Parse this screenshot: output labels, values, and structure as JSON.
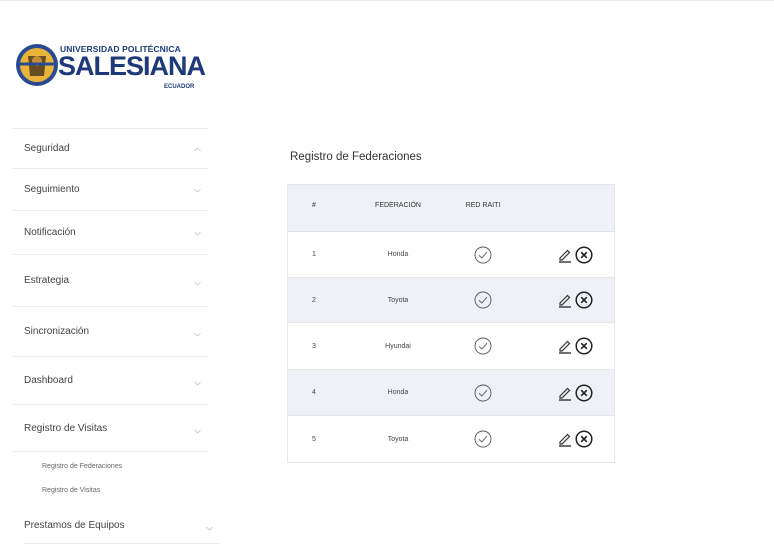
{
  "logo": {
    "university_line": "UNIVERSIDAD POLITÉCNICA",
    "name": "SALESIANA",
    "country": "ECUADOR"
  },
  "sidebar": {
    "items": [
      {
        "label": "Seguridad",
        "icon": "chevron-up-icon"
      },
      {
        "label": "Seguimiento",
        "icon": "chevron-down-icon"
      },
      {
        "label": "Notificación",
        "icon": "chevron-down-icon"
      },
      {
        "label": "Estrategia",
        "icon": "chevron-down-icon"
      },
      {
        "label": "Sincronización",
        "icon": "chevron-down-icon"
      },
      {
        "label": "Dashboard",
        "icon": "chevron-down-icon"
      },
      {
        "label": "Registro de Visitas",
        "icon": "chevron-down-icon"
      },
      {
        "label": "Prestamos de Equipos",
        "icon": "chevron-down-icon"
      }
    ],
    "subitems": [
      {
        "label": "Registro de Federaciones"
      },
      {
        "label": "Registro de Visitas"
      }
    ]
  },
  "main": {
    "title": "Registro de Federaciones",
    "table": {
      "headers": [
        "#",
        "FEDERACIÓN",
        "RED RAITI",
        ""
      ],
      "rows": [
        {
          "num": "1",
          "federacion": "Honda",
          "red_raiti": "check-circle-icon"
        },
        {
          "num": "2",
          "federacion": "Toyota",
          "red_raiti": "check-circle-icon"
        },
        {
          "num": "3",
          "federacion": "Hyundai",
          "red_raiti": "check-circle-icon"
        },
        {
          "num": "4",
          "federacion": "Honda",
          "red_raiti": "check-circle-icon"
        },
        {
          "num": "5",
          "federacion": "Toyota",
          "red_raiti": "check-circle-icon"
        }
      ],
      "row_actions": [
        "edit-pencil-icon",
        "delete-x-circle-icon"
      ]
    }
  },
  "colors": {
    "logo_blue": "#1f3a7a",
    "logo_gold": "#e8b53a",
    "header_bg": "#eef1f6",
    "border": "#e6e6e6"
  }
}
